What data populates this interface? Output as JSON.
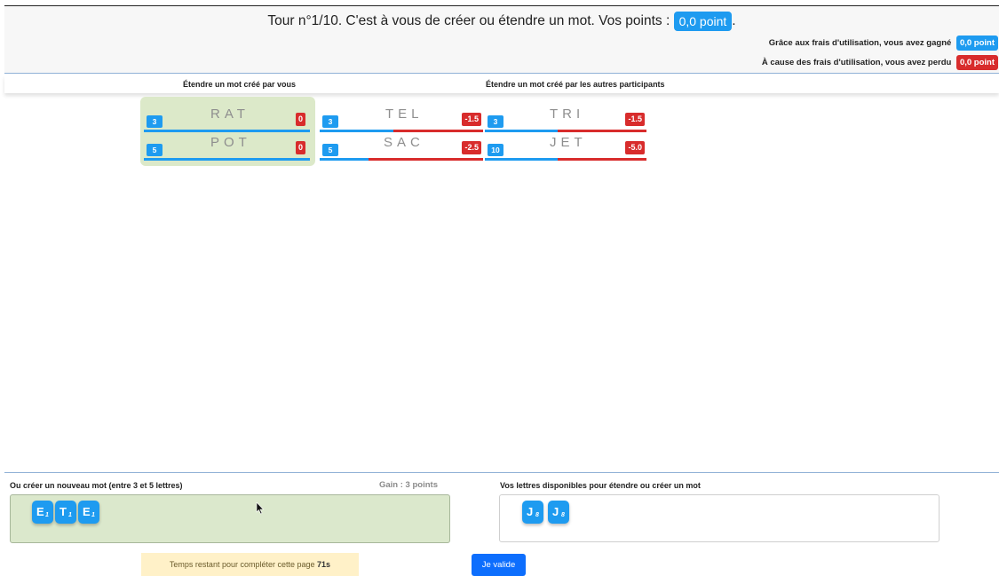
{
  "header": {
    "title_prefix": "Tour n°1/10. C'est à vous de créer ou étendre un mot. Vos points :",
    "points": "0,0 point",
    "title_suffix": ".",
    "gain_label": "Grâce aux frais d'utilisation, vous avez gagné",
    "gain_value": "0,0 point",
    "loss_label": "À cause des frais d'utilisation, vous avez perdu",
    "loss_value": "0,0 point"
  },
  "sections": {
    "own": "Étendre un mot créé par vous",
    "others": "Étendre un mot créé par les autres participants"
  },
  "own_words": [
    {
      "count": "3",
      "word": "RAT",
      "score": "0",
      "owner_share": 1.0
    },
    {
      "count": "5",
      "word": "POT",
      "score": "0",
      "owner_share": 1.0
    }
  ],
  "other_words": [
    {
      "count": "3",
      "word": "TEL",
      "score": "-1.5",
      "owner_share": 0.45
    },
    {
      "count": "3",
      "word": "TRI",
      "score": "-1.5",
      "owner_share": 0.45
    },
    {
      "count": "5",
      "word": "SAC",
      "score": "-2.5",
      "owner_share": 0.3
    },
    {
      "count": "10",
      "word": "JET",
      "score": "-5.0",
      "owner_share": 0.45
    }
  ],
  "create": {
    "label": "Ou créer un nouveau mot (entre 3 et 5 lettres)",
    "gain": "Gain : 3 points",
    "tiles": [
      {
        "letter": "E",
        "value": "1"
      },
      {
        "letter": "T",
        "value": "1"
      },
      {
        "letter": "E",
        "value": "1"
      }
    ]
  },
  "available": {
    "label": "Vos lettres disponibles pour étendre ou créer un mot",
    "tiles": [
      {
        "letter": "J",
        "value": "8"
      },
      {
        "letter": "J",
        "value": "8"
      }
    ]
  },
  "timer": {
    "label": "Temps restant pour compléter cette page",
    "value": "71s"
  },
  "validate_label": "Je valide",
  "colors": {
    "blue": "#1e9bf0",
    "red": "#d82c2c",
    "green_area": "#dce9c9",
    "timer_bg": "#fff1c8",
    "button": "#0d6efd"
  }
}
